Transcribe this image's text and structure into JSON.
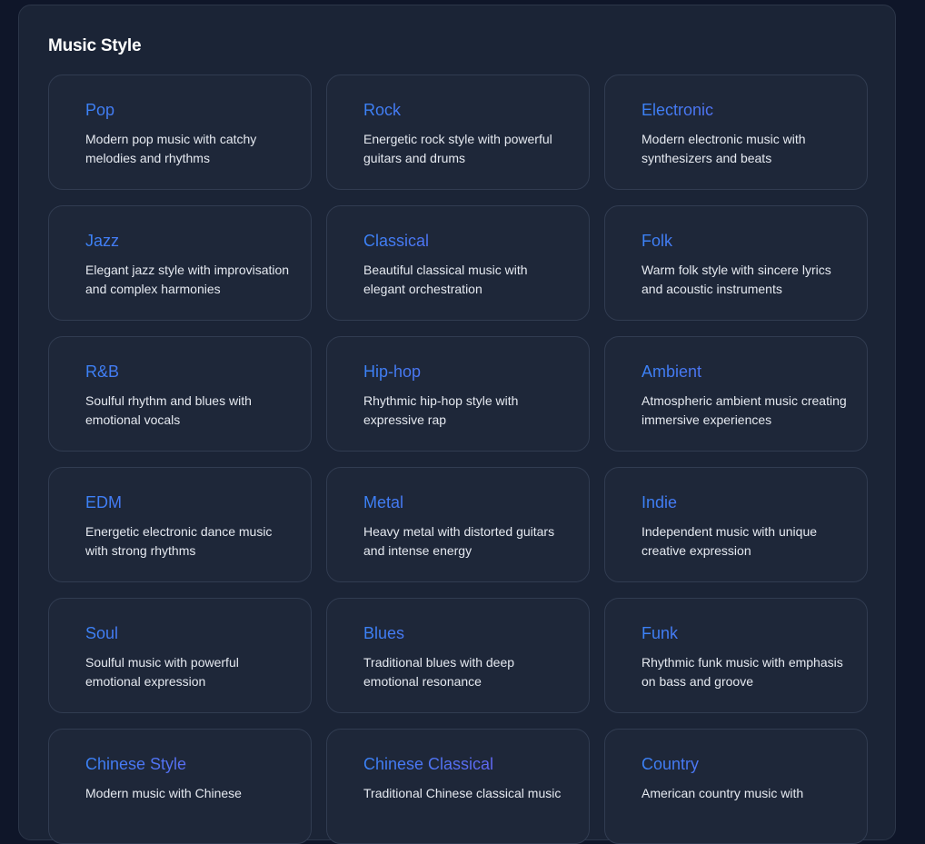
{
  "section": {
    "title": "Music Style"
  },
  "colors": {
    "page_bg": "#0f1629",
    "panel_bg": "#1b2436",
    "card_bg": "#1e2739",
    "card_border": "#313c51",
    "title_gradient_start": "#3b82f6",
    "title_gradient_end": "#8b5cf6",
    "text": "#e5e9f0"
  },
  "styles": [
    {
      "name": "Pop",
      "description": "Modern pop music with catchy melodies and rhythms"
    },
    {
      "name": "Rock",
      "description": "Energetic rock style with powerful guitars and drums"
    },
    {
      "name": "Electronic",
      "description": "Modern electronic music with synthesizers and beats"
    },
    {
      "name": "Jazz",
      "description": "Elegant jazz style with improvisation and complex harmonies"
    },
    {
      "name": "Classical",
      "description": "Beautiful classical music with elegant orchestration"
    },
    {
      "name": "Folk",
      "description": "Warm folk style with sincere lyrics and acoustic instruments"
    },
    {
      "name": "R&B",
      "description": "Soulful rhythm and blues with emotional vocals"
    },
    {
      "name": "Hip-hop",
      "description": "Rhythmic hip-hop style with expressive rap"
    },
    {
      "name": "Ambient",
      "description": "Atmospheric ambient music creating immersive experiences"
    },
    {
      "name": "EDM",
      "description": "Energetic electronic dance music with strong rhythms"
    },
    {
      "name": "Metal",
      "description": "Heavy metal with distorted guitars and intense energy"
    },
    {
      "name": "Indie",
      "description": "Independent music with unique creative expression"
    },
    {
      "name": "Soul",
      "description": "Soulful music with powerful emotional expression"
    },
    {
      "name": "Blues",
      "description": "Traditional blues with deep emotional resonance"
    },
    {
      "name": "Funk",
      "description": "Rhythmic funk music with emphasis on bass and groove"
    },
    {
      "name": "Chinese Style",
      "description": "Modern music with Chinese"
    },
    {
      "name": "Chinese Classical",
      "description": "Traditional Chinese classical music"
    },
    {
      "name": "Country",
      "description": "American country music with"
    }
  ]
}
